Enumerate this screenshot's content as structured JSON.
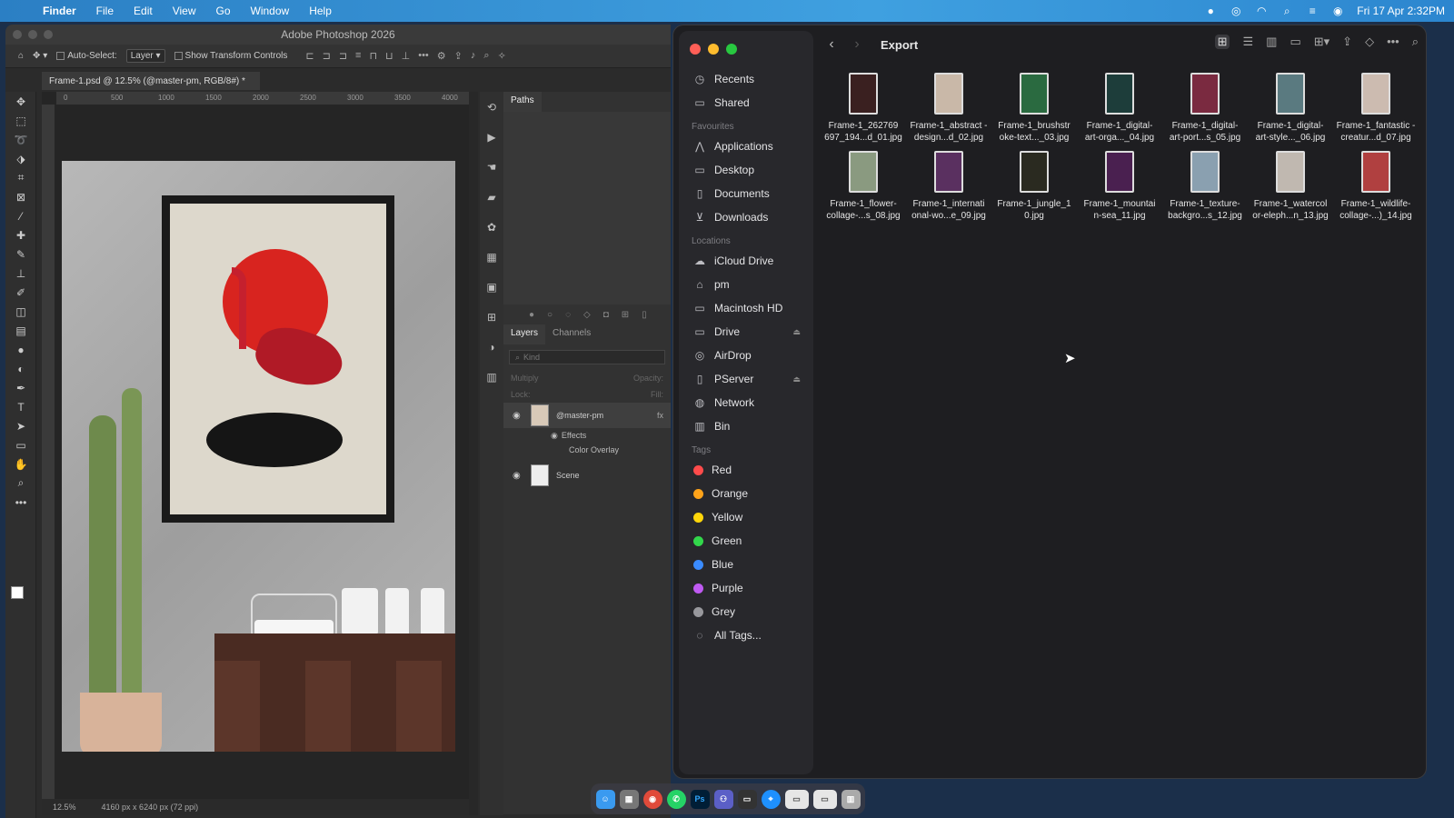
{
  "menubar": {
    "app": "Finder",
    "items": [
      "File",
      "Edit",
      "View",
      "Go",
      "Window",
      "Help"
    ],
    "datetime": "Fri 17 Apr  2:32PM"
  },
  "photoshop": {
    "window_title": "Adobe Photoshop 2026",
    "options": {
      "auto_select": "Auto-Select:",
      "layer_select": "Layer",
      "show_transform": "Show Transform Controls"
    },
    "doc_tab": "Frame-1.psd @ 12.5% (@master-pm, RGB/8#) *",
    "ruler_ticks": [
      "0",
      "500",
      "1000",
      "1500",
      "2000",
      "2500",
      "3000",
      "3500",
      "4000"
    ],
    "status": {
      "zoom": "12.5%",
      "dimensions": "4160 px x 6240 px (72 ppi)"
    },
    "paths_panel": {
      "tab": "Paths"
    },
    "layers_panel": {
      "tabs": [
        "Layers",
        "Channels"
      ],
      "search_placeholder": "Kind",
      "blend_mode": "Multiply",
      "opacity_label": "Opacity:",
      "lock_label": "Lock:",
      "fill_label": "Fill:",
      "layers": [
        {
          "name": "@master-pm",
          "fx": "fx"
        },
        {
          "name": "Scene"
        }
      ],
      "effects_label": "Effects",
      "effect_name": "Color Overlay"
    }
  },
  "finder": {
    "title": "Export",
    "sidebar": {
      "top": [
        {
          "label": "Recents",
          "icon": "clock-icon"
        },
        {
          "label": "Shared",
          "icon": "shared-folder-icon"
        }
      ],
      "favourites_heading": "Favourites",
      "favourites": [
        {
          "label": "Applications",
          "icon": "applications-icon"
        },
        {
          "label": "Desktop",
          "icon": "desktop-icon"
        },
        {
          "label": "Documents",
          "icon": "document-icon"
        },
        {
          "label": "Downloads",
          "icon": "download-icon"
        }
      ],
      "locations_heading": "Locations",
      "locations": [
        {
          "label": "iCloud Drive",
          "icon": "cloud-icon"
        },
        {
          "label": "pm",
          "icon": "home-icon"
        },
        {
          "label": "Macintosh HD",
          "icon": "disk-icon"
        },
        {
          "label": "Drive",
          "icon": "disk-icon",
          "eject": true
        },
        {
          "label": "AirDrop",
          "icon": "airdrop-icon"
        },
        {
          "label": "PServer",
          "icon": "server-icon",
          "eject": true
        },
        {
          "label": "Network",
          "icon": "globe-icon"
        },
        {
          "label": "Bin",
          "icon": "trash-icon"
        }
      ],
      "tags_heading": "Tags",
      "tags": [
        {
          "label": "Red",
          "color": "#ff4b4b"
        },
        {
          "label": "Orange",
          "color": "#ffa31a"
        },
        {
          "label": "Yellow",
          "color": "#ffd60a"
        },
        {
          "label": "Green",
          "color": "#32d74b"
        },
        {
          "label": "Blue",
          "color": "#3a8bff"
        },
        {
          "label": "Purple",
          "color": "#bf5af2"
        },
        {
          "label": "Grey",
          "color": "#98989d"
        }
      ],
      "all_tags": "All Tags..."
    },
    "files": [
      {
        "name": "Frame-1_262769 697_194...d_01.jpg",
        "color": "#3a2020"
      },
      {
        "name": "Frame-1_abstract -design...d_02.jpg",
        "color": "#c9b8a8"
      },
      {
        "name": "Frame-1_brushstr oke-text..._03.jpg",
        "color": "#2a6a40"
      },
      {
        "name": "Frame-1_digital- art-orga..._04.jpg",
        "color": "#1d3d3a"
      },
      {
        "name": "Frame-1_digital- art-port...s_05.jpg",
        "color": "#7a2a40"
      },
      {
        "name": "Frame-1_digital- art-style..._06.jpg",
        "color": "#5a7a80"
      },
      {
        "name": "Frame-1_fantastic -creatur...d_07.jpg",
        "color": "#ccbbb0"
      },
      {
        "name": "Frame-1_flower- collage-...s_08.jpg",
        "color": "#8a9a80"
      },
      {
        "name": "Frame-1_internati onal-wo...e_09.jpg",
        "color": "#5a3060"
      },
      {
        "name": "Frame-1_jungle_1 0.jpg",
        "color": "#2a2a20"
      },
      {
        "name": "Frame-1_mountai n-sea_11.jpg",
        "color": "#4a2050"
      },
      {
        "name": "Frame-1_texture- backgro...s_12.jpg",
        "color": "#8aa0b0"
      },
      {
        "name": "Frame-1_watercol or-eleph...n_13.jpg",
        "color": "#c0b8b0"
      },
      {
        "name": "Frame-1_wildlife- collage-...)_14.jpg",
        "color": "#b04040"
      }
    ]
  },
  "dock": [
    "Finder",
    "Calculator",
    "Chrome",
    "WhatsApp",
    "Ps",
    "Teams",
    "Terminal",
    "Safari",
    "Folder",
    "Folder",
    "Trash"
  ]
}
